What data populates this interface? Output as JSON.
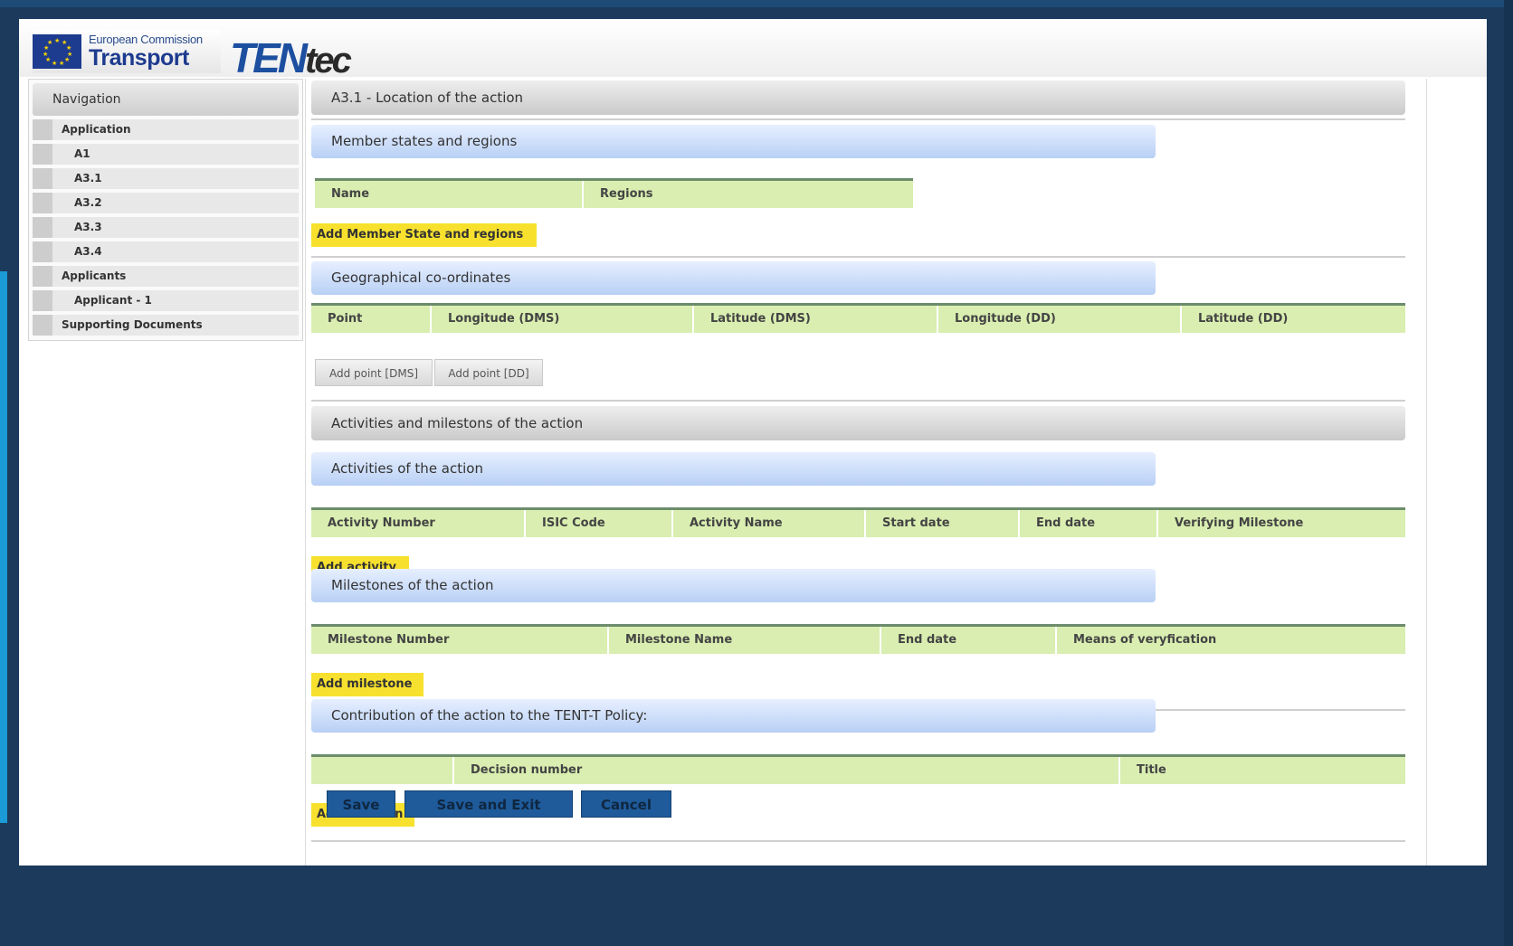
{
  "header": {
    "ec_small": "European Commission",
    "ec_big": "Transport",
    "tentec_ten": "TEN",
    "tentec_tec": "tec"
  },
  "navigation": {
    "title": "Navigation",
    "items": [
      {
        "label": "Application",
        "level": 0
      },
      {
        "label": "A1",
        "level": 1
      },
      {
        "label": "A3.1",
        "level": 1
      },
      {
        "label": "A3.2",
        "level": 1
      },
      {
        "label": "A3.3",
        "level": 1
      },
      {
        "label": "A3.4",
        "level": 1
      },
      {
        "label": "Applicants",
        "level": 0
      },
      {
        "label": "Applicant - 1",
        "level": 1
      },
      {
        "label": "Supporting Documents",
        "level": 0
      }
    ]
  },
  "page": {
    "title": "A3.1 - Location of the action"
  },
  "member_states": {
    "heading": "Member states and regions",
    "columns": [
      "Name",
      "Regions"
    ],
    "add_button": "Add Member State and regions"
  },
  "geo": {
    "heading": "Geographical co-ordinates",
    "columns": [
      "Point",
      "Longitude (DMS)",
      "Latitude (DMS)",
      "Longitude (DD)",
      "Latitude (DD)"
    ],
    "add_dms": "Add point [DMS]",
    "add_dd": "Add point [DD]"
  },
  "activities_section": {
    "heading": "Activities and milestons of the action"
  },
  "activities": {
    "heading": "Activities of the action",
    "columns": [
      "Activity Number",
      "ISIC Code",
      "Activity Name",
      "Start date",
      "End date",
      "Verifying Milestone"
    ],
    "add_button": "Add activity"
  },
  "milestones": {
    "heading": "Milestones of the action",
    "columns": [
      "Milestone Number",
      "Milestone Name",
      "End date",
      "Means of veryfication"
    ],
    "add_button": "Add milestone"
  },
  "contribution": {
    "heading": "Contribution of the action to the TENT-T Policy:",
    "columns": [
      "",
      "Decision number",
      "Title"
    ],
    "add_button": "Add Decision"
  },
  "actions": {
    "save": "Save",
    "save_exit": "Save and Exit",
    "cancel": "Cancel"
  },
  "colors": {
    "page_background": "#1b3a5c",
    "table_header": "#d9eeb0",
    "add_button": "#f7e12e",
    "action_button": "#1f5b9b",
    "section_bar": "#b8d0f5"
  }
}
